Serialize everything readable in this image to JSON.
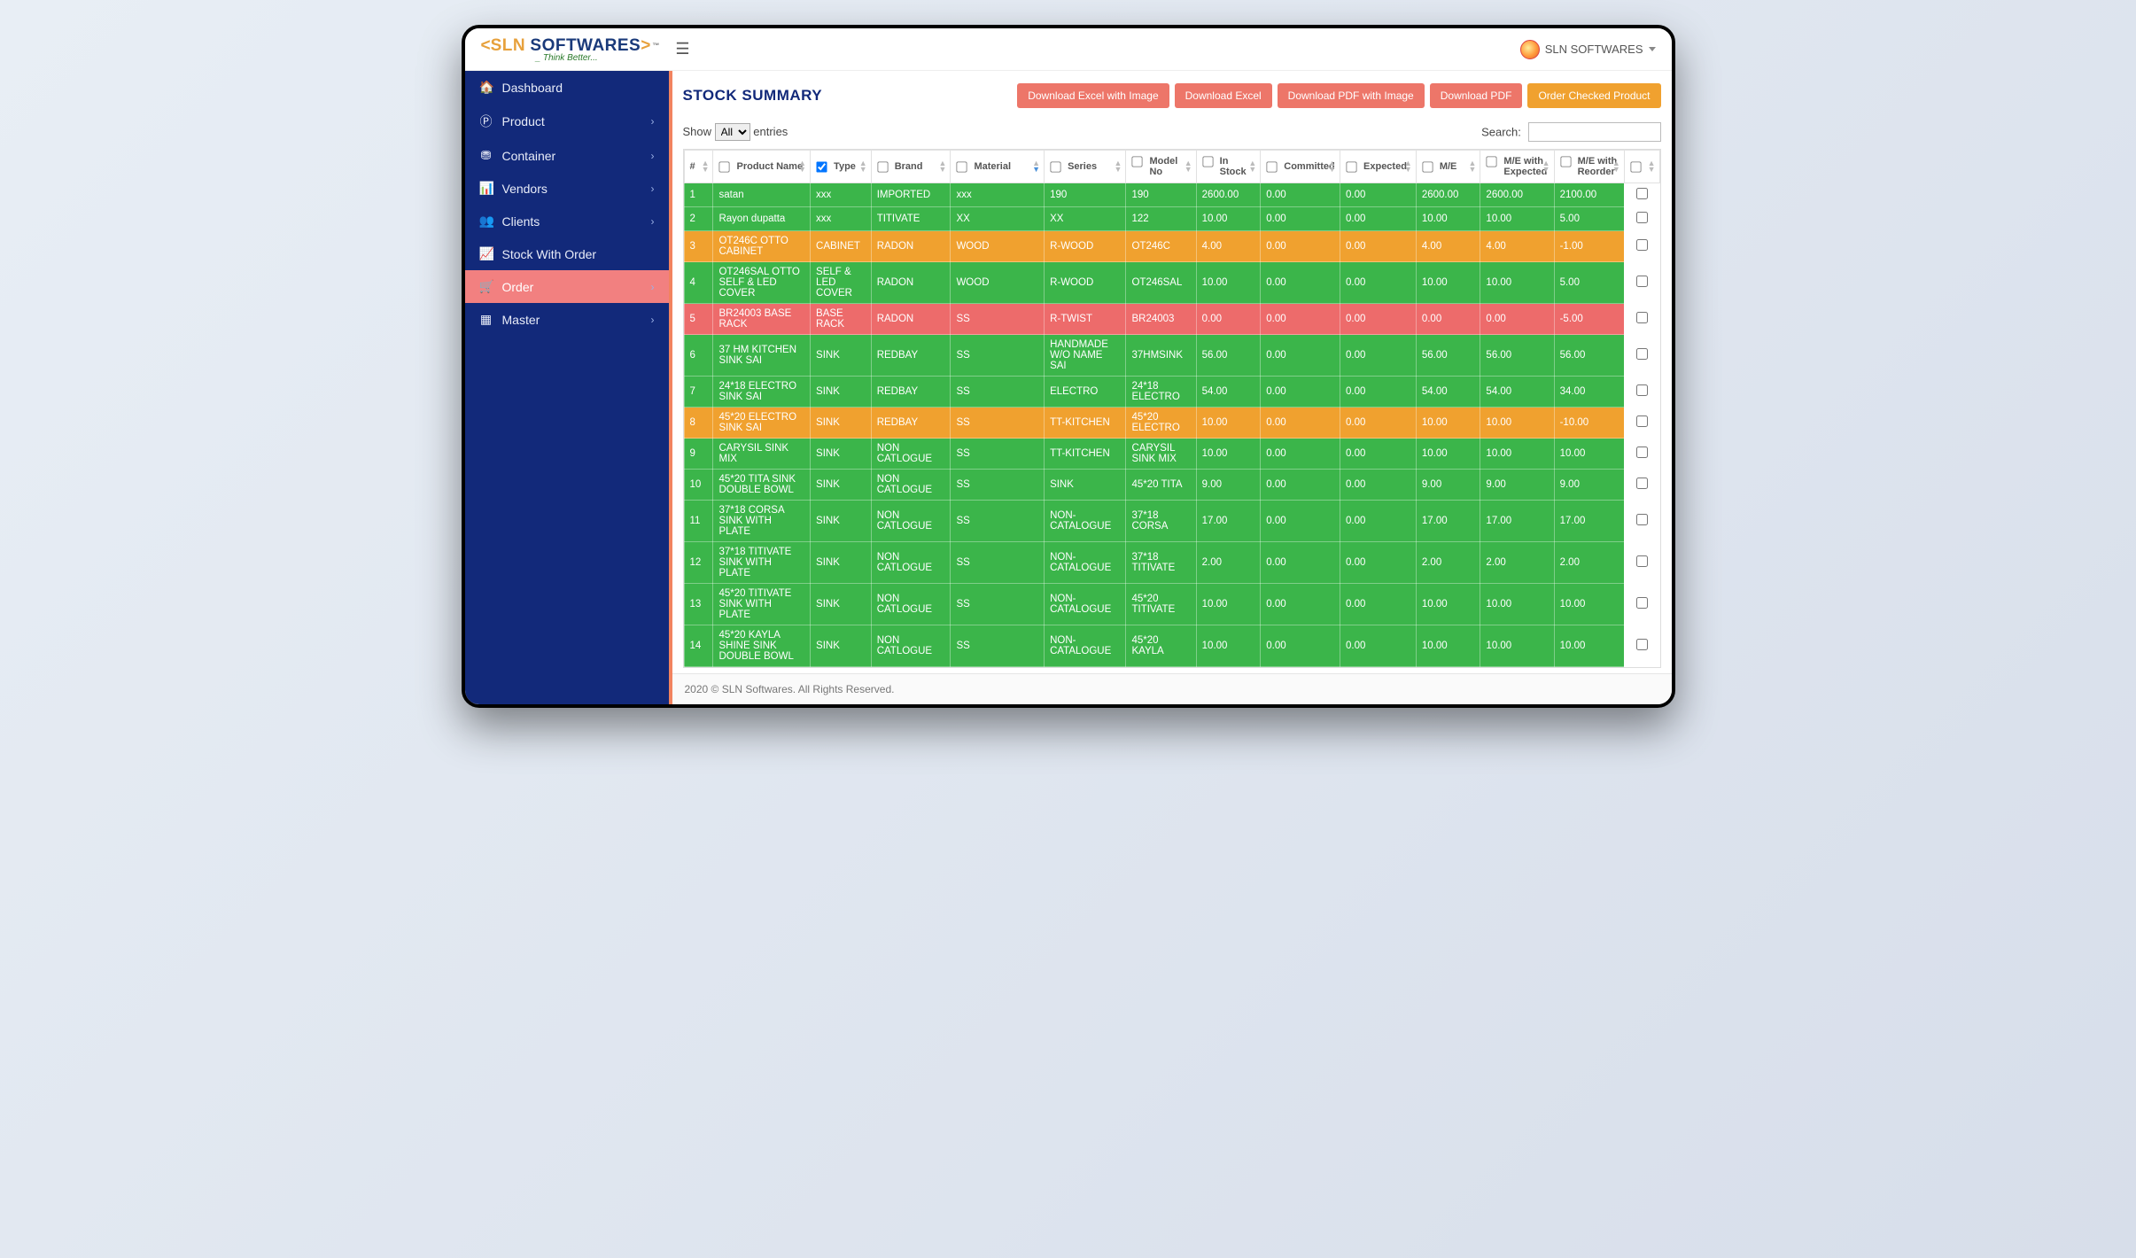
{
  "topbar": {
    "logo_sln": "SLN",
    "logo_soft": "SOFTWARES",
    "logo_tm": "™",
    "tagline": "_ Think Better...",
    "user_label": "SLN SOFTWARES"
  },
  "sidebar": {
    "items": [
      {
        "icon": "home",
        "label": "Dashboard",
        "expandable": false
      },
      {
        "icon": "p",
        "label": "Product",
        "expandable": true
      },
      {
        "icon": "drop",
        "label": "Container",
        "expandable": true
      },
      {
        "icon": "bar",
        "label": "Vendors",
        "expandable": true
      },
      {
        "icon": "users",
        "label": "Clients",
        "expandable": true
      },
      {
        "icon": "line",
        "label": "Stock With Order",
        "expandable": false
      },
      {
        "icon": "cart",
        "label": "Order",
        "expandable": true,
        "active": true
      },
      {
        "icon": "grid",
        "label": "Master",
        "expandable": true
      }
    ]
  },
  "page": {
    "title": "STOCK SUMMARY",
    "buttons": {
      "dl_excel_img": "Download Excel with Image",
      "dl_excel": "Download Excel",
      "dl_pdf_img": "Download PDF with Image",
      "dl_pdf": "Download PDF",
      "order_checked": "Order Checked Product"
    },
    "table_controls": {
      "show_prefix": "Show",
      "show_suffix": "entries",
      "length_option": "All",
      "search_label": "Search:"
    }
  },
  "columns": [
    {
      "key": "idx",
      "label": "#",
      "checkbox": false,
      "width": "2.5%"
    },
    {
      "key": "name",
      "label": "Product Name",
      "checkbox": true,
      "width": "8.3%"
    },
    {
      "key": "type",
      "label": "Type",
      "checkbox": true,
      "checked": true,
      "width": "5.2%"
    },
    {
      "key": "brand",
      "label": "Brand",
      "checkbox": true,
      "width": "6.8%"
    },
    {
      "key": "material",
      "label": "Material",
      "checkbox": true,
      "sorted": "down",
      "width": "8%"
    },
    {
      "key": "series",
      "label": "Series",
      "checkbox": true,
      "width": "7%"
    },
    {
      "key": "model",
      "label": "Model No",
      "checkbox": true,
      "width": "6%"
    },
    {
      "key": "instock",
      "label": "In Stock",
      "checkbox": true,
      "width": "5.5%"
    },
    {
      "key": "committed",
      "label": "Committed",
      "checkbox": true,
      "width": "6.8%"
    },
    {
      "key": "expected",
      "label": "Expected",
      "checkbox": true,
      "width": "6.5%"
    },
    {
      "key": "me",
      "label": "M/E",
      "checkbox": true,
      "width": "5.5%"
    },
    {
      "key": "me_exp",
      "label": "M/E with Expected",
      "checkbox": true,
      "width": "6.3%"
    },
    {
      "key": "me_reord",
      "label": "M/E with Reorder",
      "checkbox": true,
      "width": "6%"
    },
    {
      "key": "chk",
      "label": "",
      "headerCheckboxOnly": true,
      "width": "3%"
    }
  ],
  "rows": [
    {
      "color": "green",
      "cells": [
        "1",
        "satan",
        "xxx",
        "IMPORTED",
        "xxx",
        "190",
        "190",
        "2600.00",
        "0.00",
        "0.00",
        "2600.00",
        "2600.00",
        "2100.00"
      ]
    },
    {
      "color": "green",
      "cells": [
        "2",
        "Rayon dupatta",
        "xxx",
        "TITIVATE",
        "XX",
        "XX",
        "122",
        "10.00",
        "0.00",
        "0.00",
        "10.00",
        "10.00",
        "5.00"
      ]
    },
    {
      "color": "orange",
      "cells": [
        "3",
        "OT246C OTTO CABINET",
        "CABINET",
        "RADON",
        "WOOD",
        "R-WOOD",
        "OT246C",
        "4.00",
        "0.00",
        "0.00",
        "4.00",
        "4.00",
        "-1.00"
      ]
    },
    {
      "color": "green",
      "cells": [
        "4",
        "OT246SAL OTTO SELF & LED COVER",
        "SELF & LED COVER",
        "RADON",
        "WOOD",
        "R-WOOD",
        "OT246SAL",
        "10.00",
        "0.00",
        "0.00",
        "10.00",
        "10.00",
        "5.00"
      ]
    },
    {
      "color": "red",
      "cells": [
        "5",
        "BR24003 BASE RACK",
        "BASE RACK",
        "RADON",
        "SS",
        "R-TWIST",
        "BR24003",
        "0.00",
        "0.00",
        "0.00",
        "0.00",
        "0.00",
        "-5.00"
      ]
    },
    {
      "color": "green",
      "cells": [
        "6",
        "37 HM KITCHEN SINK SAI",
        "SINK",
        "REDBAY",
        "SS",
        "HANDMADE W/O NAME SAI",
        "37HMSINK",
        "56.00",
        "0.00",
        "0.00",
        "56.00",
        "56.00",
        "56.00"
      ]
    },
    {
      "color": "green",
      "cells": [
        "7",
        "24*18 ELECTRO SINK SAI",
        "SINK",
        "REDBAY",
        "SS",
        "ELECTRO",
        "24*18 ELECTRO",
        "54.00",
        "0.00",
        "0.00",
        "54.00",
        "54.00",
        "34.00"
      ]
    },
    {
      "color": "orange",
      "cells": [
        "8",
        "45*20 ELECTRO SINK SAI",
        "SINK",
        "REDBAY",
        "SS",
        "TT-KITCHEN",
        "45*20 ELECTRO",
        "10.00",
        "0.00",
        "0.00",
        "10.00",
        "10.00",
        "-10.00"
      ]
    },
    {
      "color": "green",
      "cells": [
        "9",
        "CARYSIL SINK MIX",
        "SINK",
        "NON CATLOGUE",
        "SS",
        "TT-KITCHEN",
        "CARYSIL SINK MIX",
        "10.00",
        "0.00",
        "0.00",
        "10.00",
        "10.00",
        "10.00"
      ]
    },
    {
      "color": "green",
      "cells": [
        "10",
        "45*20 TITA SINK DOUBLE BOWL",
        "SINK",
        "NON CATLOGUE",
        "SS",
        "SINK",
        "45*20 TITA",
        "9.00",
        "0.00",
        "0.00",
        "9.00",
        "9.00",
        "9.00"
      ]
    },
    {
      "color": "green",
      "cells": [
        "11",
        "37*18 CORSA SINK WITH PLATE",
        "SINK",
        "NON CATLOGUE",
        "SS",
        "NON-CATALOGUE",
        "37*18 CORSA",
        "17.00",
        "0.00",
        "0.00",
        "17.00",
        "17.00",
        "17.00"
      ]
    },
    {
      "color": "green",
      "cells": [
        "12",
        "37*18 TITIVATE SINK WITH PLATE",
        "SINK",
        "NON CATLOGUE",
        "SS",
        "NON-CATALOGUE",
        "37*18 TITIVATE",
        "2.00",
        "0.00",
        "0.00",
        "2.00",
        "2.00",
        "2.00"
      ]
    },
    {
      "color": "green",
      "cells": [
        "13",
        "45*20 TITIVATE SINK WITH PLATE",
        "SINK",
        "NON CATLOGUE",
        "SS",
        "NON-CATALOGUE",
        "45*20 TITIVATE",
        "10.00",
        "0.00",
        "0.00",
        "10.00",
        "10.00",
        "10.00"
      ]
    },
    {
      "color": "green",
      "cells": [
        "14",
        "45*20 KAYLA SHINE SINK DOUBLE BOWL",
        "SINK",
        "NON CATLOGUE",
        "SS",
        "NON-CATALOGUE",
        "45*20 KAYLA",
        "10.00",
        "0.00",
        "0.00",
        "10.00",
        "10.00",
        "10.00"
      ]
    }
  ],
  "footer": {
    "text": "2020 © SLN Softwares. All Rights Reserved."
  }
}
